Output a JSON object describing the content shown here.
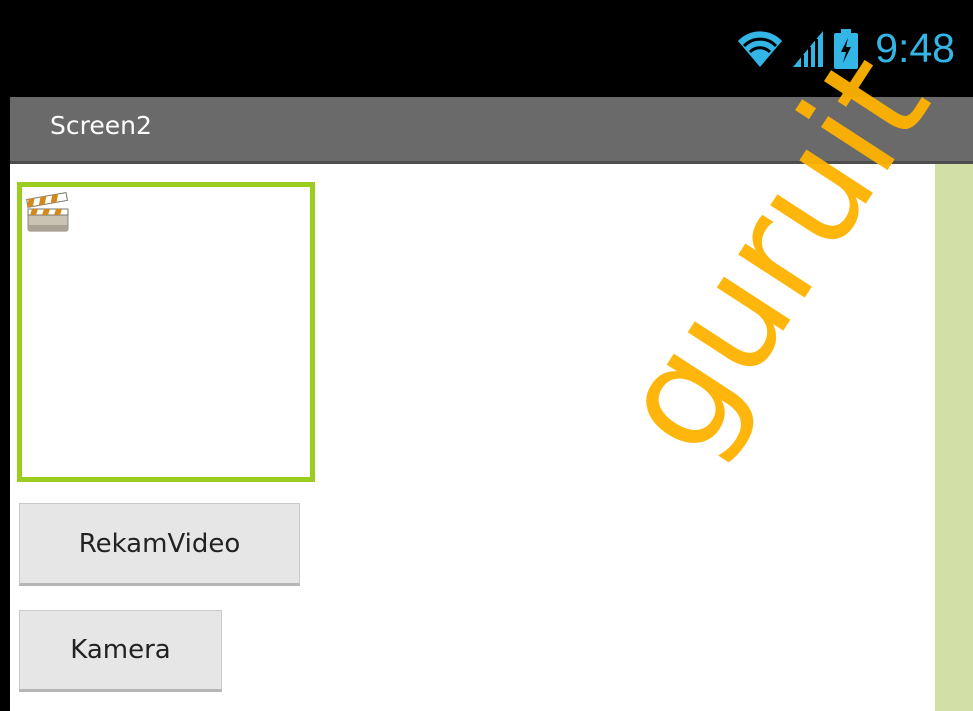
{
  "status_bar": {
    "time": "9:48",
    "icons": [
      "wifi-icon",
      "signal-icon",
      "battery-icon"
    ],
    "icon_color": "#33b5e5"
  },
  "title_bar": {
    "title": "Screen2"
  },
  "video_player": {
    "icon": "clapperboard-icon",
    "border_color": "#9acd1e"
  },
  "buttons": {
    "rekam_video": "RekamVideo",
    "kamera": "Kamera"
  },
  "scrollbar": {
    "color": "#d2dfa6"
  },
  "watermark": {
    "text": "guruit",
    "color": "#ffb300"
  }
}
